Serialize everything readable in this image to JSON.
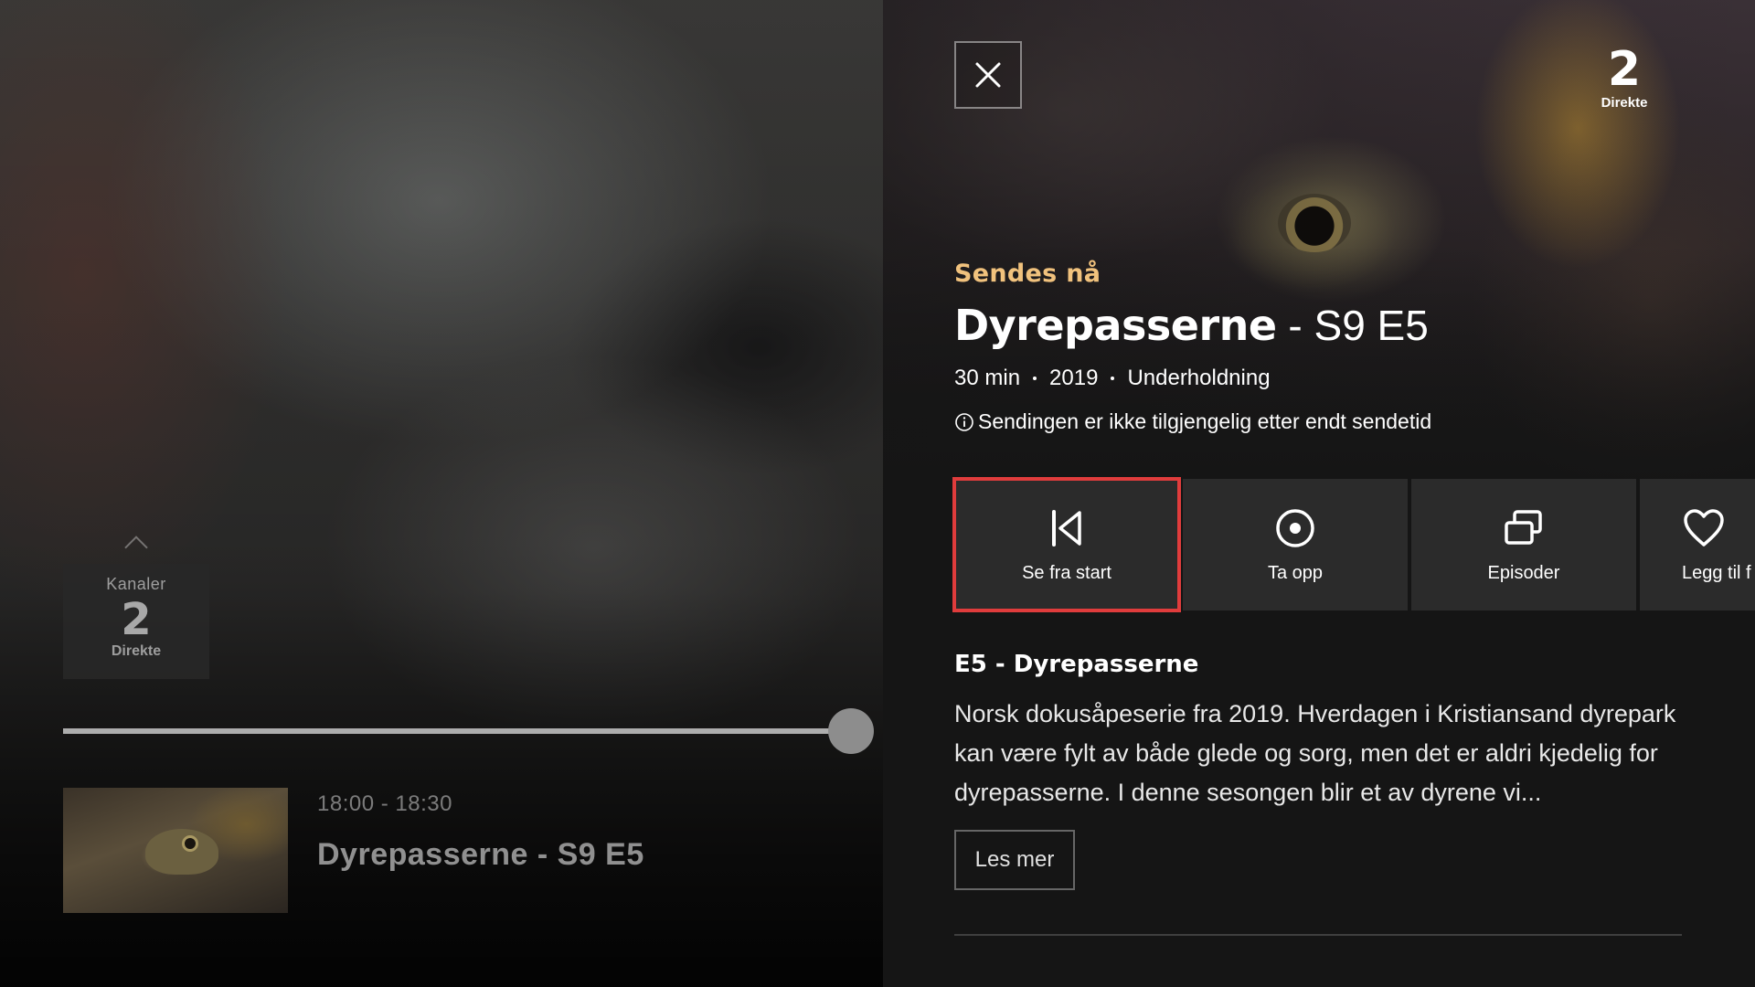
{
  "player": {
    "channel_switcher": {
      "label": "Kanaler",
      "logo": "2",
      "sub": "Direkte"
    },
    "progress_fraction": 0.98,
    "program": {
      "time": "18:00 - 18:30",
      "title": "Dyrepasserne - S9 E5"
    }
  },
  "panel": {
    "close_icon": "close-icon",
    "channel": {
      "logo": "2",
      "sub": "Direkte"
    },
    "live_label": "Sendes nå",
    "title": "Dyrepasserne",
    "title_sep": " - ",
    "episode": "S9 E5",
    "meta": {
      "duration": "30 min",
      "year": "2019",
      "genre": "Underholdning"
    },
    "availability": "Sendingen er ikke tilgjengelig etter endt sendetid",
    "actions": [
      {
        "label": "Se fra start",
        "icon": "skip-back-icon"
      },
      {
        "label": "Ta opp",
        "icon": "record-icon"
      },
      {
        "label": "Episoder",
        "icon": "episodes-icon"
      },
      {
        "label": "Legg til f",
        "icon": "heart-icon"
      }
    ],
    "description": {
      "title": "E5 - Dyrepasserne",
      "text": "Norsk dokusåpeserie fra 2019. Hverdagen i Kristiansand dyrepark kan være fylt av både glede og sorg, men det er aldri kjedelig for dyrepasserne. I denne sesongen blir et av dyrene vi...",
      "read_more": "Les mer"
    }
  },
  "colors": {
    "accent": "#f1c27d",
    "focus": "#e03c3c"
  }
}
